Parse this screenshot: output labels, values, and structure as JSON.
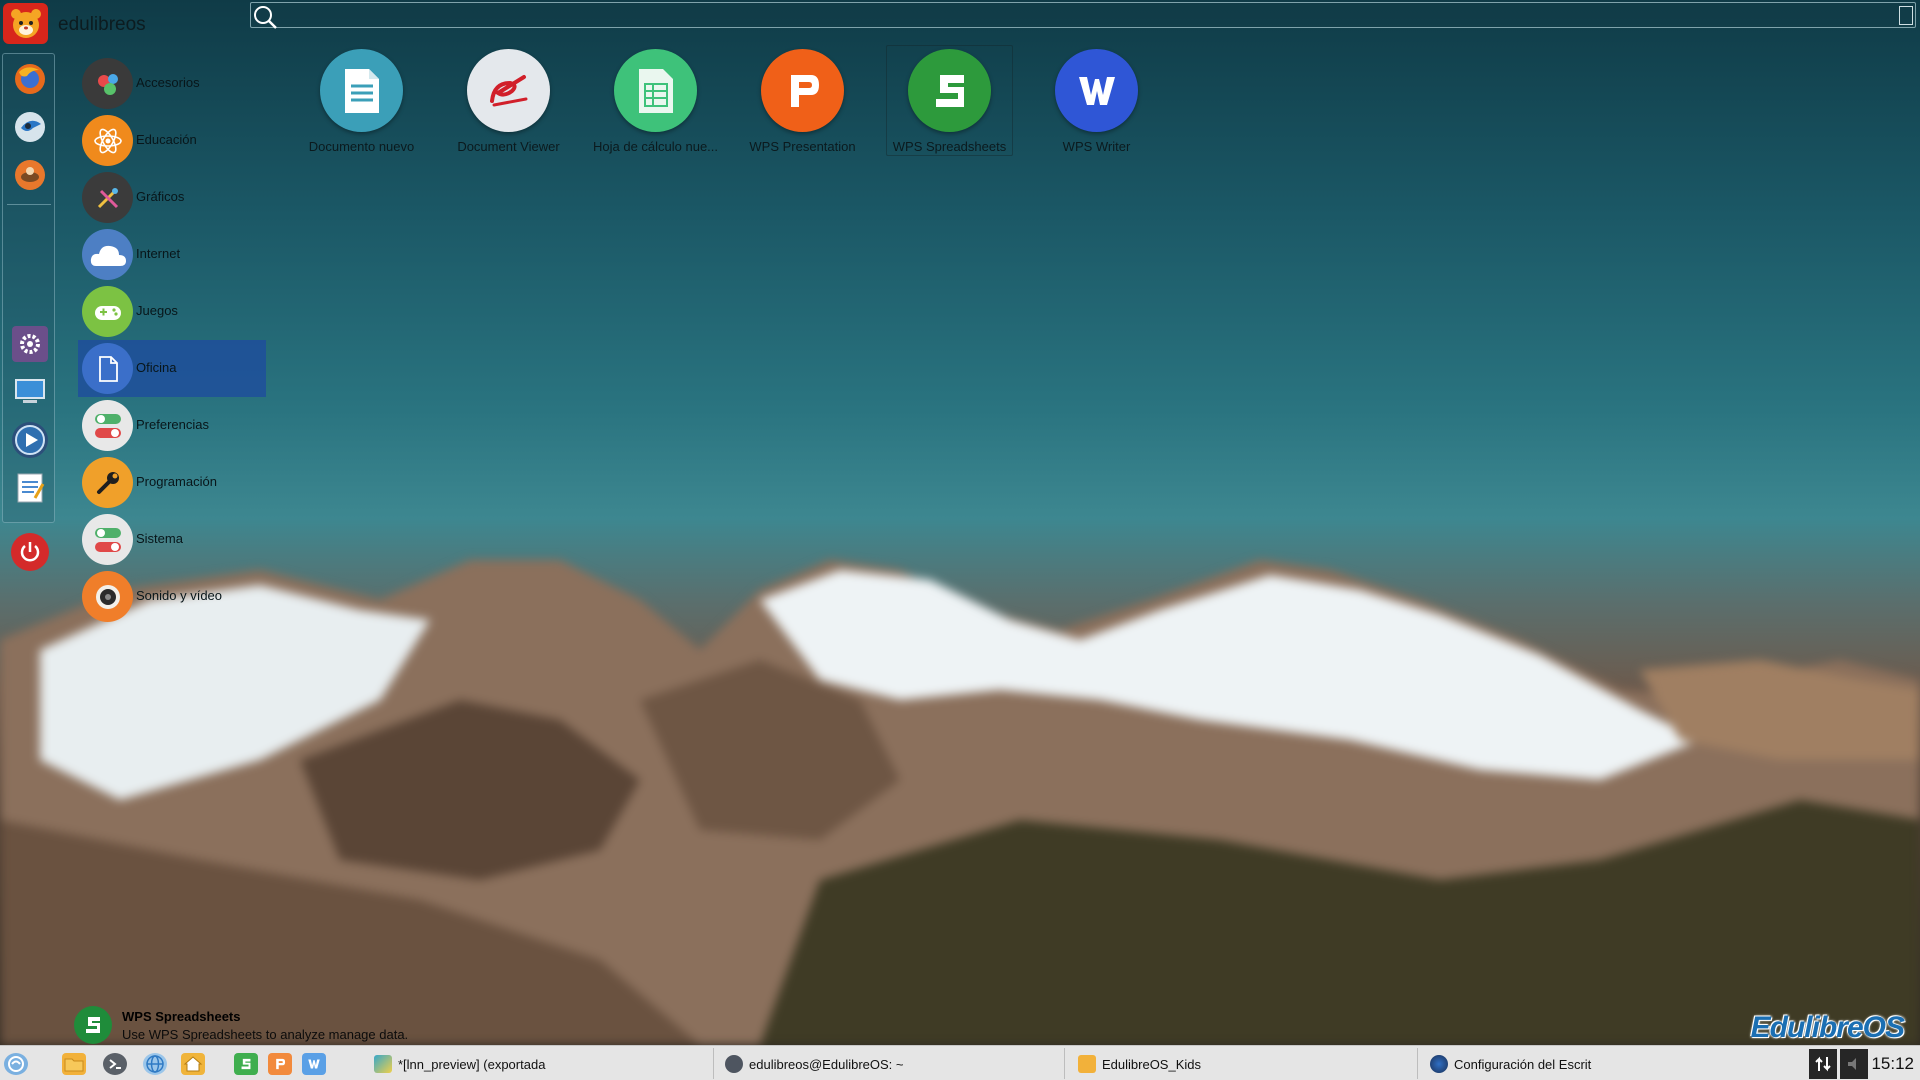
{
  "header": {
    "username": "edulibreos",
    "search": {
      "value": "",
      "placeholder": ""
    }
  },
  "favorites": [
    {
      "name": "firefox-icon"
    },
    {
      "name": "mail-client-icon"
    },
    {
      "name": "media-tool-icon"
    },
    {
      "name": "settings-icon"
    },
    {
      "name": "remote-desktop-icon"
    },
    {
      "name": "media-player-icon"
    },
    {
      "name": "text-editor-icon"
    }
  ],
  "categories": [
    {
      "label": "Accesorios",
      "icon": "accessories-icon",
      "color": "#3a3a3a"
    },
    {
      "label": "Educación",
      "icon": "education-icon",
      "color": "#f08a1c"
    },
    {
      "label": "Gráficos",
      "icon": "graphics-icon",
      "color": "#3b3b3b"
    },
    {
      "label": "Internet",
      "icon": "internet-cloud-icon",
      "color": "#4d7fc4"
    },
    {
      "label": "Juegos",
      "icon": "gamepad-icon",
      "color": "#7cc243"
    },
    {
      "label": "Oficina",
      "icon": "document-icon",
      "color": "#3b6fc9",
      "active": true
    },
    {
      "label": "Preferencias",
      "icon": "preferences-toggle-icon",
      "color": "#e8e8e8"
    },
    {
      "label": "Programación",
      "icon": "wrench-icon",
      "color": "#f0a02a"
    },
    {
      "label": "Sistema",
      "icon": "system-toggle-icon",
      "color": "#e8e8e8"
    },
    {
      "label": "Sonido y vídeo",
      "icon": "speaker-icon",
      "color": "#f07e2a"
    }
  ],
  "apps": [
    {
      "label": "Documento nuevo",
      "icon": "new-document-icon",
      "color": "#3b9fb8"
    },
    {
      "label": "Document Viewer",
      "icon": "document-viewer-icon",
      "color": "#e4e8ec"
    },
    {
      "label": "Hoja de cálculo nue...",
      "icon": "new-spreadsheet-icon",
      "color": "#3ec27a"
    },
    {
      "label": "WPS Presentation",
      "icon": "wps-presentation-icon",
      "color": "#f06018"
    },
    {
      "label": "WPS Spreadsheets",
      "icon": "wps-spreadsheets-icon",
      "color": "#2d9a3c",
      "selected": true
    },
    {
      "label": "WPS Writer",
      "icon": "wps-writer-icon",
      "color": "#2f56d6"
    }
  ],
  "description": {
    "name": "WPS Spreadsheets",
    "text": "Use WPS Spreadsheets to analyze manage data."
  },
  "brand": {
    "text": "EdulibreOS"
  },
  "taskbar": {
    "launchers": [
      {
        "name": "start-menu-icon"
      },
      {
        "name": "file-manager-icon"
      },
      {
        "name": "terminal-icon"
      },
      {
        "name": "web-browser-icon"
      },
      {
        "name": "home-folder-icon"
      },
      {
        "name": "wps-spreadsheets-icon"
      },
      {
        "name": "wps-presentation-icon"
      },
      {
        "name": "wps-writer-icon"
      }
    ],
    "tasks": [
      {
        "label": "*[lnn_preview] (exportada"
      },
      {
        "label": "edulibreos@EdulibreOS: ~"
      },
      {
        "label": "EdulibreOS_Kids"
      },
      {
        "label": "Configuración del Escrit"
      }
    ],
    "clock": "15:12"
  }
}
